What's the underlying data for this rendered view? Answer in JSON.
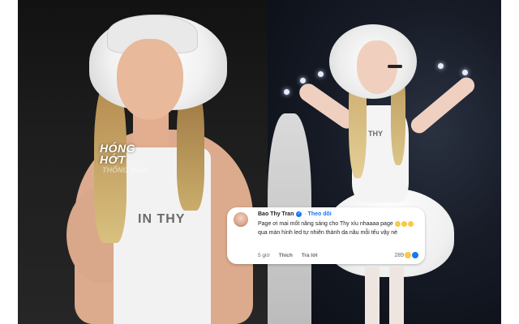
{
  "left_photo": {
    "watermark_line1": "HÓNG",
    "watermark_line2": "HỚT",
    "watermark_small": "THÔNG BÁO",
    "shirt_text": "IN THY"
  },
  "right_photo": {
    "shirt_text": "THY"
  },
  "comment": {
    "author": "Bao Thy Tran",
    "follow_label": "Theo dõi",
    "text_part1": "Page ơi mai mốt nâng sáng cho Thy xíu nhaaaa page",
    "text_part2": "qua màn hình led tự nhiên thành da nâu mỗi tếu vậy nè",
    "time": "5 giờ",
    "like_label": "Thích",
    "reply_label": "Trả lời",
    "reaction_count": "289"
  }
}
